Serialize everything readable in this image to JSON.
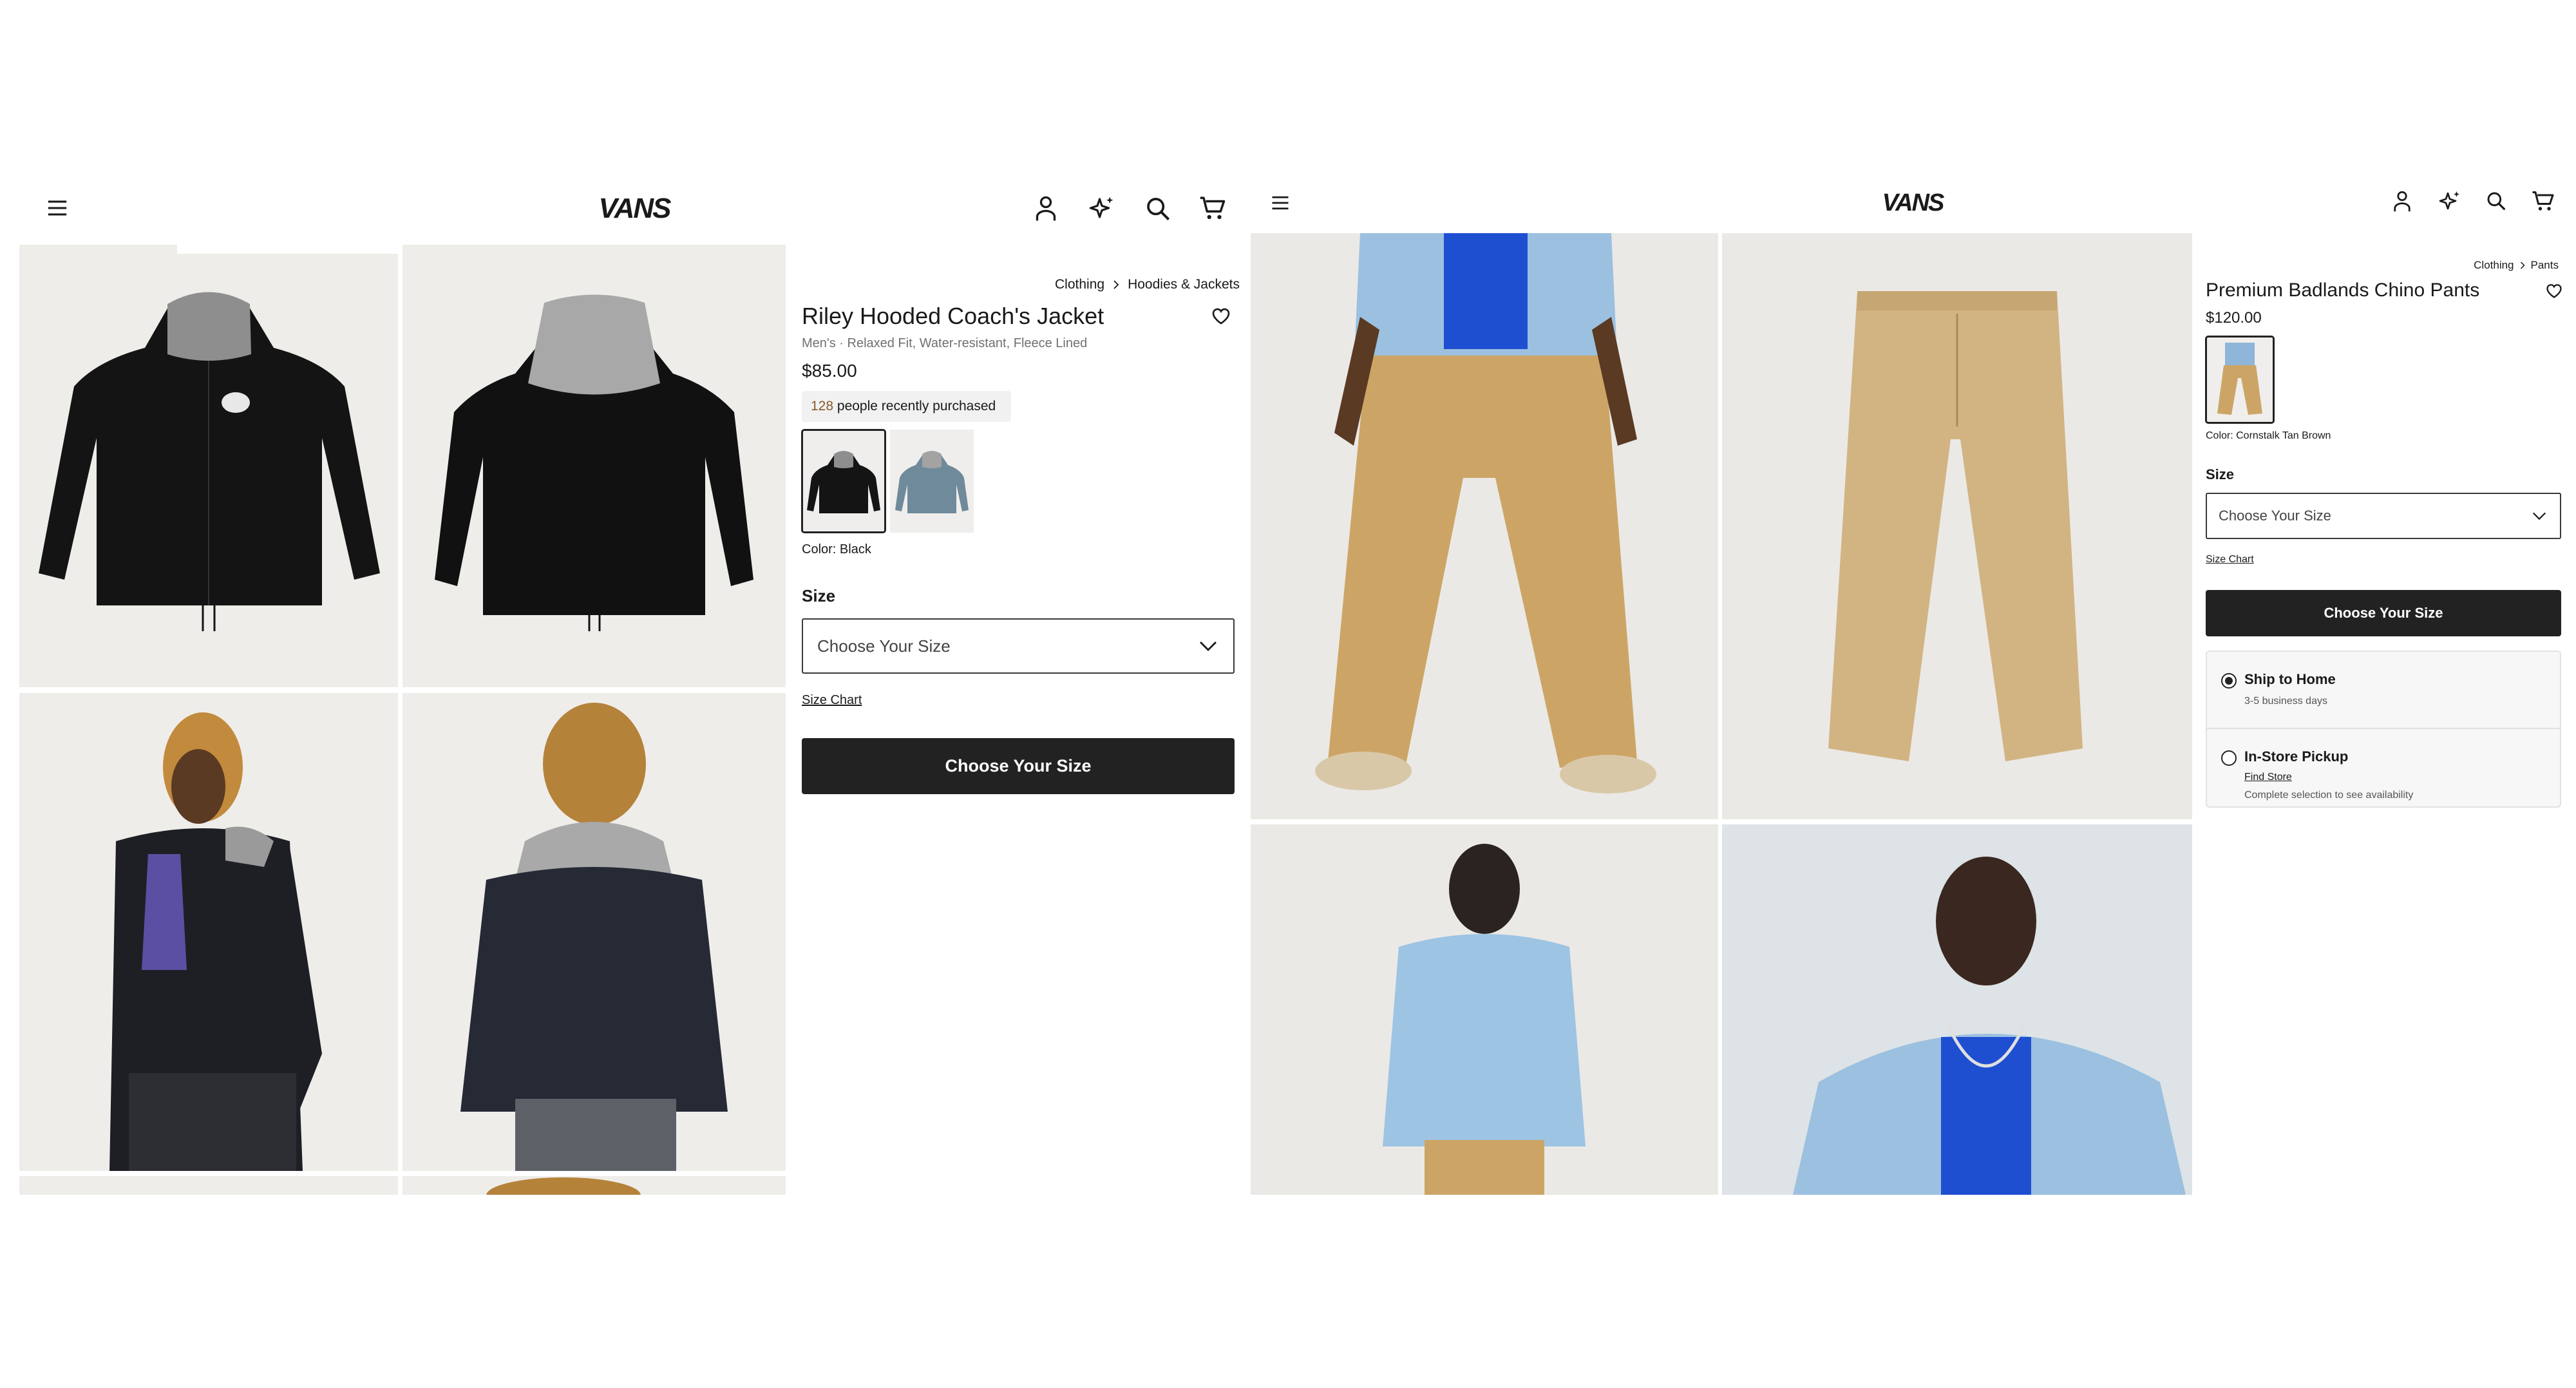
{
  "brand": "VANS",
  "colors": {
    "cta_bg": "#222222",
    "badge_count": "#8a5a2b",
    "muted": "#707070"
  },
  "left": {
    "header": {
      "icons": [
        "menu-icon",
        "account-icon",
        "sparkle-icon",
        "search-icon",
        "cart-icon"
      ]
    },
    "breadcrumb": [
      "Clothing",
      "Hoodies & Jackets"
    ],
    "product": {
      "title": "Riley Hooded Coach's Jacket",
      "subtitle": "Men's · Relaxed Fit, Water-resistant, Fleece Lined",
      "price": "$85.00",
      "recent_count": "128",
      "recent_text": "people recently purchased",
      "color_label": "Color: Black",
      "size_label": "Size",
      "size_placeholder": "Choose Your Size",
      "size_chart": "Size Chart",
      "cta": "Choose Your Size"
    },
    "swatches": [
      {
        "name": "Black",
        "selected": true
      },
      {
        "name": "Blue",
        "selected": false
      }
    ]
  },
  "right": {
    "header": {
      "icons": [
        "menu-icon",
        "account-icon",
        "sparkle-icon",
        "search-icon",
        "cart-icon"
      ]
    },
    "breadcrumb": [
      "Clothing",
      "Pants"
    ],
    "product": {
      "title": "Premium Badlands Chino Pants",
      "price": "$120.00",
      "color_label": "Color: Cornstalk Tan Brown",
      "size_label": "Size",
      "size_placeholder": "Choose Your Size",
      "size_chart": "Size Chart",
      "cta": "Choose Your Size"
    },
    "swatches": [
      {
        "name": "Cornstalk Tan Brown",
        "selected": true
      }
    ],
    "delivery": [
      {
        "title": "Ship to Home",
        "subtitle": "3-5 business days",
        "selected": true
      },
      {
        "title": "In-Store Pickup",
        "link": "Find Store",
        "subtitle": "Complete selection to see availability",
        "selected": false
      }
    ]
  }
}
